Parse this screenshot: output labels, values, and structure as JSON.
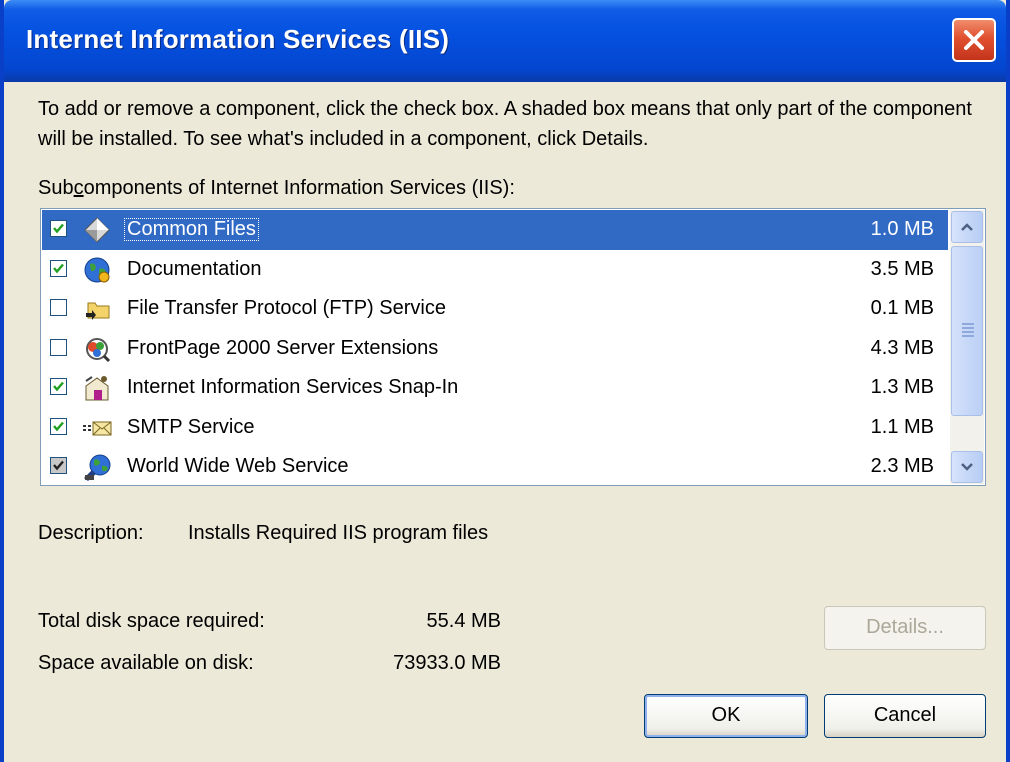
{
  "window": {
    "title": "Internet Information Services (IIS)"
  },
  "instructions": "To add or remove a component, click the check box. A shaded box means that only part of the component will be installed. To see what's included in a component, click Details.",
  "subcomponents_label": {
    "prefix": "Sub",
    "accel": "c",
    "suffix": "omponents of Internet Information Services (IIS):"
  },
  "components": [
    {
      "name": "Common Files",
      "size": "1.0 MB",
      "checked": true,
      "shaded": false,
      "selected": true,
      "icon": "diamond-icon"
    },
    {
      "name": "Documentation",
      "size": "3.5 MB",
      "checked": true,
      "shaded": false,
      "selected": false,
      "icon": "globe-icon"
    },
    {
      "name": "File Transfer Protocol (FTP) Service",
      "size": "0.1 MB",
      "checked": false,
      "shaded": false,
      "selected": false,
      "icon": "folder-icon"
    },
    {
      "name": "FrontPage 2000 Server Extensions",
      "size": "4.3 MB",
      "checked": false,
      "shaded": false,
      "selected": false,
      "icon": "frontpage-icon"
    },
    {
      "name": "Internet Information Services Snap-In",
      "size": "1.3 MB",
      "checked": true,
      "shaded": false,
      "selected": false,
      "icon": "mmc-snapin-icon"
    },
    {
      "name": "SMTP Service",
      "size": "1.1 MB",
      "checked": true,
      "shaded": false,
      "selected": false,
      "icon": "envelope-icon"
    },
    {
      "name": "World Wide Web Service",
      "size": "2.3 MB",
      "checked": true,
      "shaded": true,
      "selected": false,
      "icon": "web-service-icon"
    }
  ],
  "description": {
    "label": "Description:",
    "text": "Installs Required IIS program files"
  },
  "disk": {
    "required_label": "Total disk space required:",
    "required_value": "55.4 MB",
    "available_label": "Space available on disk:",
    "available_value": "73933.0 MB"
  },
  "buttons": {
    "details": "Details...",
    "ok": "OK",
    "cancel": "Cancel"
  }
}
